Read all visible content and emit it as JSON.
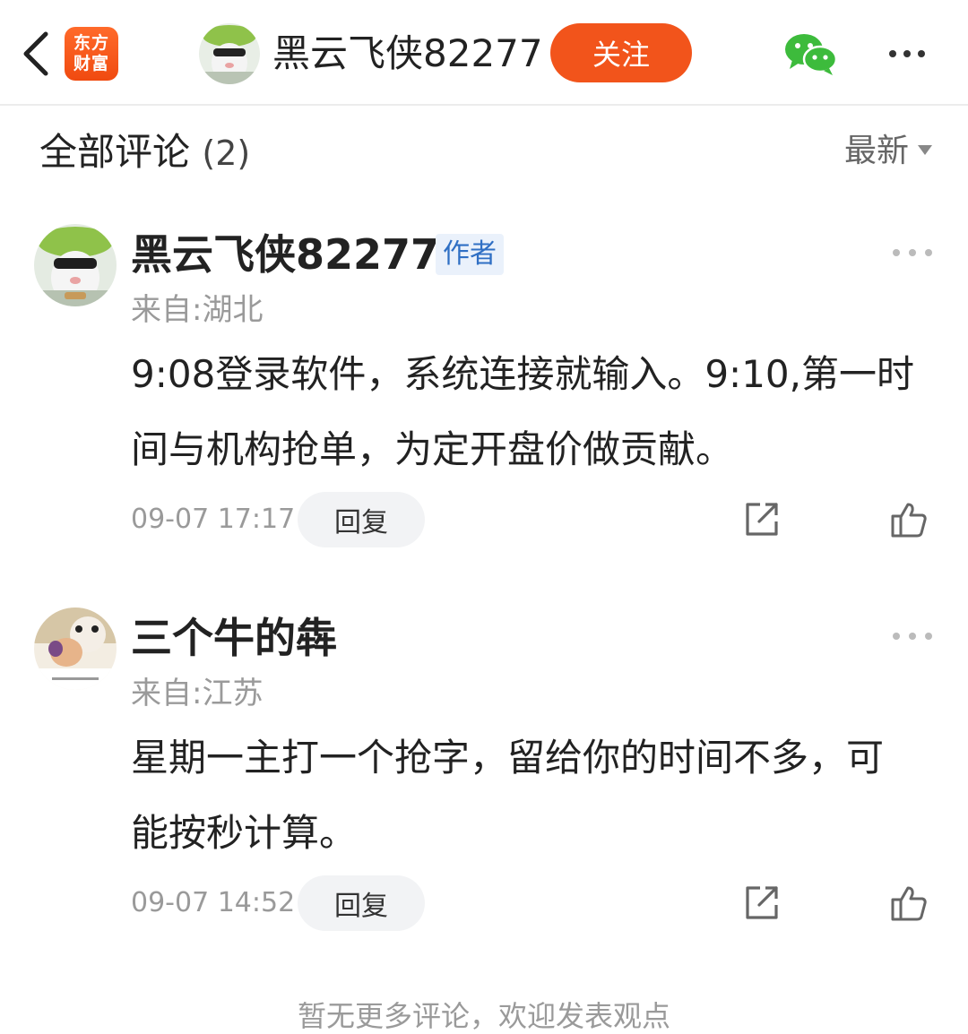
{
  "header": {
    "logo_line1": "东方",
    "logo_line2": "财富",
    "username": "黑云飞侠82277",
    "follow_label": "关注"
  },
  "section": {
    "title": "全部评论",
    "count": "(2)",
    "sort_label": "最新"
  },
  "comments": [
    {
      "username": "黑云飞侠82277",
      "author_tag": "作者",
      "location": "来自:湖北",
      "text": "9:08登录软件，系统连接就输入。9:10,第一时间与机构抢单，为定开盘价做贡献。",
      "time": "09-07 17:17",
      "reply_label": "回复"
    },
    {
      "username": "三个牛的犇",
      "location": "来自:江苏",
      "text": "星期一主打一个抢字，留给你的时间不多，可能按秒计算。",
      "time": "09-07 14:52",
      "reply_label": "回复"
    }
  ],
  "footer": {
    "note": "暂无更多评论，欢迎发表观点"
  },
  "colors": {
    "brand": "#f2541b",
    "author_tag_bg": "#eaf1fb",
    "author_tag_text": "#2f6fc4",
    "wechat_green": "#3dbb3c"
  },
  "icons": {
    "back": "chevron-left-icon",
    "share": "share-icon",
    "like": "thumbs-up-icon",
    "wechat": "wechat-icon",
    "more": "more-dots-icon"
  }
}
